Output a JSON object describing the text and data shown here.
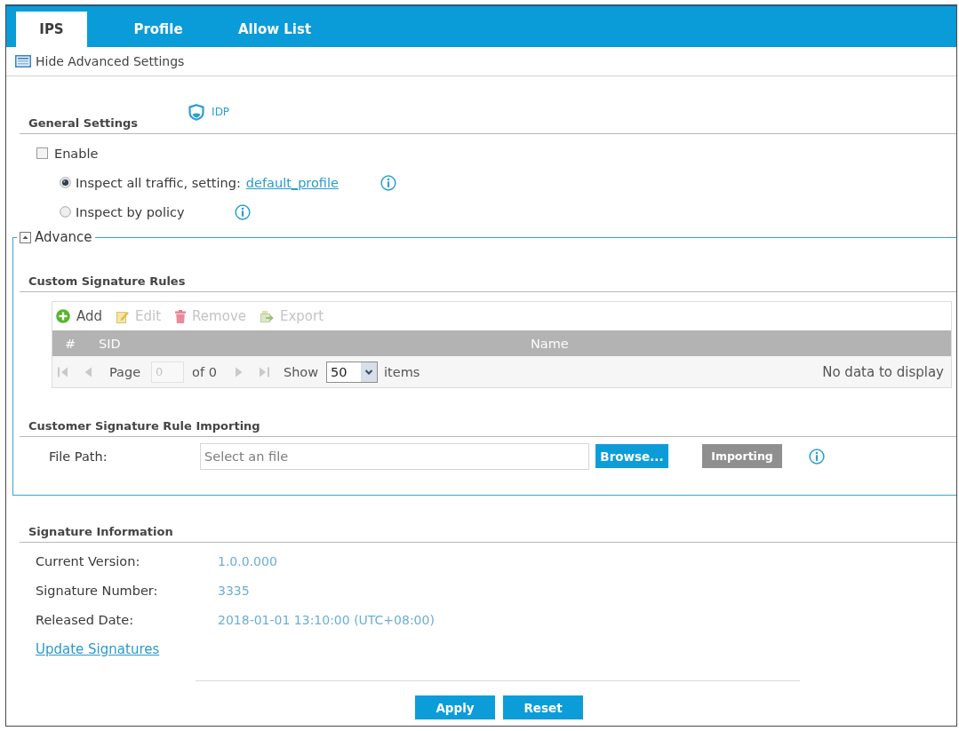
{
  "tabs": [
    {
      "label": "IPS",
      "selected": true
    },
    {
      "label": "Profile",
      "selected": false
    },
    {
      "label": "Allow List",
      "selected": false
    }
  ],
  "advanced_toggle": {
    "label": "Hide Advanced Settings"
  },
  "general_settings": {
    "title": "General Settings",
    "badge": "IDP",
    "enable": {
      "label": "Enable",
      "checked": false
    },
    "modes": [
      {
        "label": "Inspect all traffic, setting:",
        "link": "default_profile",
        "selected": true
      },
      {
        "label": "Inspect by policy",
        "selected": false
      }
    ]
  },
  "advance": {
    "legend": "Advance",
    "expanded": true,
    "custom_signature_rules": {
      "title": "Custom Signature Rules",
      "toolbar": [
        {
          "kind": "add",
          "label": "Add",
          "disabled": false
        },
        {
          "kind": "edit",
          "label": "Edit",
          "disabled": true
        },
        {
          "kind": "remove",
          "label": "Remove",
          "disabled": true
        },
        {
          "kind": "export",
          "label": "Export",
          "disabled": true
        }
      ],
      "columns": [
        "#",
        "SID",
        "Name"
      ],
      "pager": {
        "page_label": "Page",
        "page": "0",
        "of_label": "of 0",
        "show_label": "Show",
        "per_page": "50",
        "items_label": "items"
      },
      "empty_message": "No data to display"
    },
    "rule_importing": {
      "title": "Customer Signature Rule Importing",
      "file_label": "File Path:",
      "placeholder": "Select an file",
      "browse": "Browse...",
      "import": {
        "label": "Importing",
        "disabled": true
      }
    }
  },
  "signature_information": {
    "title": "Signature Information",
    "fields": [
      {
        "label": "Current Version:",
        "value": "1.0.0.000"
      },
      {
        "label": "Signature Number:",
        "value": "3335"
      },
      {
        "label": "Released Date:",
        "value": "2018-01-01 13:10:00 (UTC+08:00)"
      }
    ],
    "update_link": "Update Signatures"
  },
  "buttons": [
    {
      "label": "Apply"
    },
    {
      "label": "Reset"
    }
  ]
}
